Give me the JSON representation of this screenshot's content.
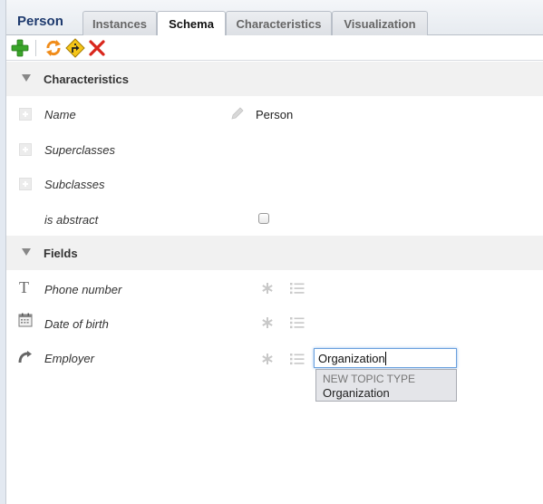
{
  "header": {
    "title": "Person",
    "tabs": [
      {
        "label": "Instances",
        "active": false
      },
      {
        "label": "Schema",
        "active": true
      },
      {
        "label": "Characteristics",
        "active": false
      },
      {
        "label": "Visualization",
        "active": false
      }
    ]
  },
  "toolbar": {
    "buttons": [
      "add-icon",
      "refresh-icon",
      "detour-icon",
      "delete-icon"
    ]
  },
  "characteristics": {
    "section_label": "Characteristics",
    "rows": [
      {
        "label": "Name",
        "value": "Person"
      },
      {
        "label": "Superclasses",
        "value": ""
      },
      {
        "label": "Subclasses",
        "value": ""
      },
      {
        "label": "is abstract",
        "checked": false
      }
    ]
  },
  "fields": {
    "section_label": "Fields",
    "rows": [
      {
        "label": "Phone number",
        "icon": "text-type-icon"
      },
      {
        "label": "Date of birth",
        "icon": "calendar-icon"
      },
      {
        "label": "Employer",
        "icon": "association-icon"
      }
    ]
  },
  "autocomplete": {
    "input_value": "Organization",
    "suggestion_header": "NEW TOPIC TYPE",
    "suggestion": "Organization"
  },
  "colors": {
    "title": "#1e3a6e",
    "section_bg": "#f1f1f1",
    "add": "#3aa52a",
    "delete": "#d9261c",
    "input_focus": "#6aa0de"
  }
}
